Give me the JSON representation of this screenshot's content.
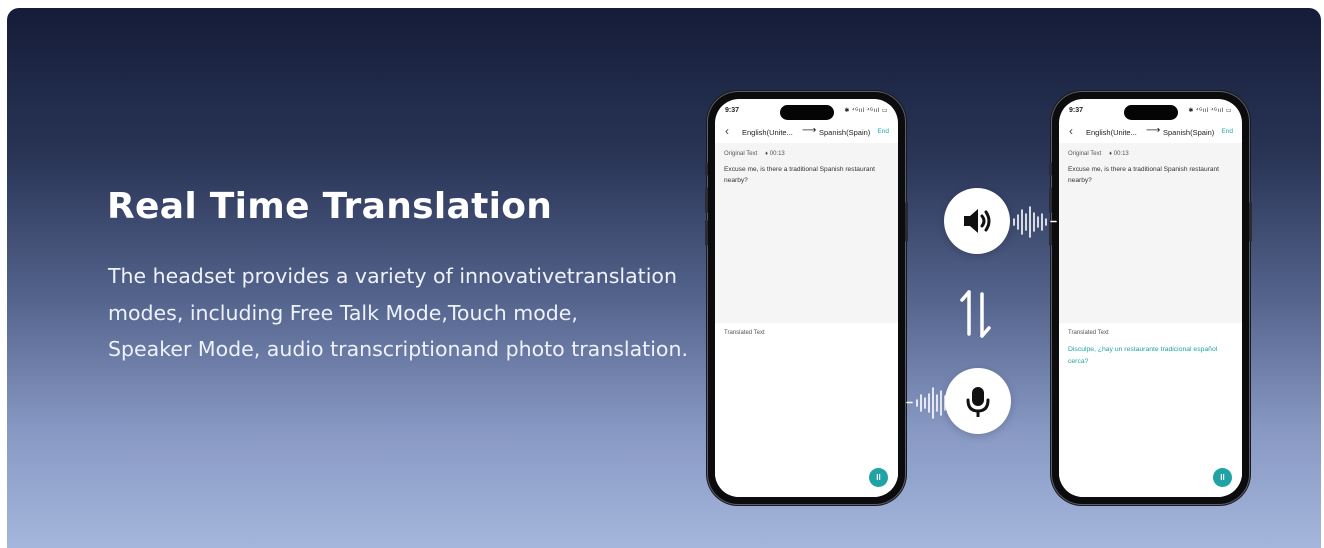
{
  "hero": {
    "title": "Real Time Translation",
    "description_lines": [
      "The headset provides a variety of innovativetranslation",
      "modes, including Free Talk Mode,Touch mode,",
      "Speaker Mode, audio transcriptionand photo translation."
    ]
  },
  "phones": [
    {
      "time": "9:37",
      "status_icons": "✱ ⁴ᴳııl ⁴ᴳııl ▭",
      "back": "‹",
      "source_lang": "English(Unite...",
      "arrow": "⟶",
      "target_lang": "Spanish(Spain)",
      "end_label": "End",
      "original_label": "Original Text",
      "timer": "♦ 00:13",
      "original_text": "Excuse me, is there a traditional Spanish restaurant nearby?",
      "translated_label": "Translated Text",
      "translated_text": "",
      "pause": "II"
    },
    {
      "time": "9:37",
      "status_icons": "✱ ⁴ᴳııl ⁴ᴳııl ▭",
      "back": "‹",
      "source_lang": "English(Unite...",
      "arrow": "⟶",
      "target_lang": "Spanish(Spain)",
      "end_label": "End",
      "original_label": "Original Text",
      "timer": "♦ 00:13",
      "original_text": "Excuse me, is there a traditional Spanish restaurant nearby?",
      "translated_label": "Translated Text",
      "translated_text": "Disculpe, ¿hay un restaurante tradicional español cerca?",
      "pause": "II"
    }
  ],
  "icons": {
    "speaker": "speaker-icon",
    "mic": "microphone-icon",
    "swap": "swap-arrows-icon",
    "wave": "sound-wave-icon"
  },
  "colors": {
    "accent": "#1fa3a4",
    "gradient_top": "#141c38",
    "gradient_bottom": "#a5b6dc"
  }
}
